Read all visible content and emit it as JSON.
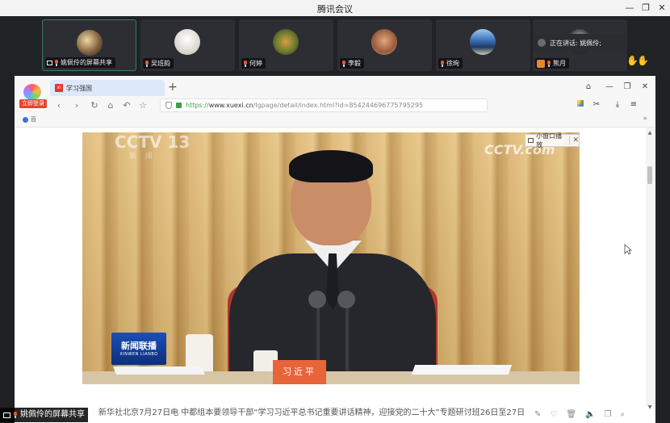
{
  "window": {
    "title": "腾讯会议",
    "controls": {
      "minimize": "—",
      "restore": "❐",
      "close": "✕"
    }
  },
  "participants": [
    {
      "name": "姚佩伶的屏幕共享",
      "avatar_color": "#7a5a3a",
      "active": true
    },
    {
      "name": "吴班韵",
      "avatar_color": "#e8e6e0",
      "active": false
    },
    {
      "name": "何婷",
      "avatar_color": "#8a6a2e",
      "active": false
    },
    {
      "name": "李毅",
      "avatar_color": "#b87a52",
      "active": false
    },
    {
      "name": "徐珣",
      "avatar_color": "#3a6fb4",
      "active": false
    },
    {
      "name": "熊月",
      "avatar_color": "#2a2a2e",
      "active": false
    }
  ],
  "speaking_indicator": {
    "label": "正在讲话: 姚佩伶;"
  },
  "browser": {
    "logo_label": "立即登录",
    "tab": {
      "title": "学习强国",
      "favicon_text": "xi"
    },
    "url": {
      "protocol": "https://",
      "host": "www.xuexi.cn",
      "path": "/lgpage/detail/index.html?id=854244696775795295"
    },
    "bookmark": "百",
    "controls": {
      "minimize": "—",
      "restore": "❐",
      "close": "✕"
    }
  },
  "video": {
    "channel_watermark": "CCTV 13",
    "channel_sub": "新 闻",
    "logo_watermark": "CCTV.com",
    "mini_window_label": "小窗口播放",
    "mini_window_close": "✕",
    "program_logo": "新闻联播",
    "program_logo_sub": "XINWEN LIANBO",
    "nameplate": "习近平"
  },
  "article_caption": "新华社北京7月27日电 中都组本要领导干部“学习习近平总书记重要讲话精神，迎接党的二十大”专题研讨班26日至27日",
  "bottom_label": "姚佩伶的屏幕共享",
  "colors": {
    "accent_green": "#36a345",
    "tab_blue": "#dde9f8",
    "mic_red": "#e85a3a"
  }
}
